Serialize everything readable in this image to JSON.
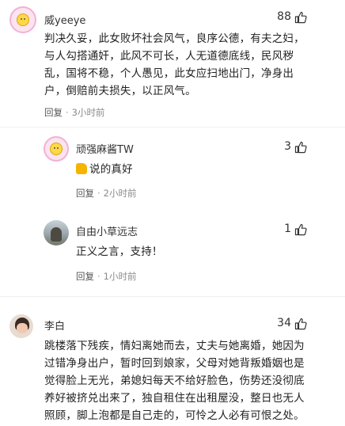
{
  "comments": [
    {
      "author": "威yeeye",
      "likes": "88",
      "text": "判决久妥，此女败坏社会风气，良序公德，有夫之妇，与人勾搭通奸，此风不可长，人无道德底线，民风秽乱，国将不稳，个人愚见，此女应扫地出门，净身出户，倒赔前夫损失，以正风气。",
      "reply_label": "回复",
      "time": "3小时前"
    },
    {
      "author": "顽强麻酱TW",
      "likes": "3",
      "text": "说的真好",
      "reply_label": "回复",
      "time": "2小时前"
    },
    {
      "author": "自由小草远志",
      "likes": "1",
      "text": "正义之言，支持！",
      "reply_label": "回复",
      "time": "1小时前"
    },
    {
      "author": "李白",
      "likes": "34",
      "text": "跳楼落下残疾，情妇离她而去，丈夫与她离婚，她因为过错净身出户，暂时回到娘家，父母对她背叛婚姻也是觉得脸上无光，弟媳妇每天不给好脸色，伤势还没彻底养好被挤兑出来了，独自租住在出租屋没，整日也无人照顾，脚上泡都是自己走的，可怜之人必有可恨之处。"
    }
  ],
  "icons": {
    "like": "thumbs-up-icon",
    "emoji": "thumbs-up-emoji"
  }
}
